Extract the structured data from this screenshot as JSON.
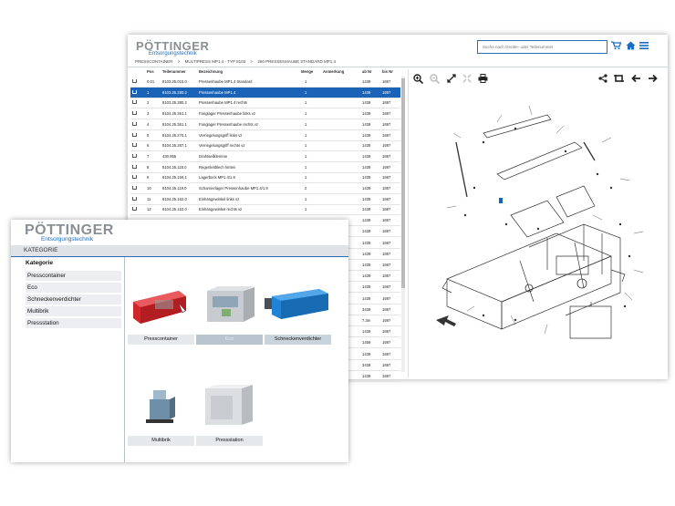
{
  "back": {
    "logo": {
      "name": "PÖTTINGER",
      "sub": "Entsorgungstechnik"
    },
    "search": {
      "placeholder": "Suche nach Geräte- oder Teilenummer"
    },
    "icons": {
      "cart": "cart-icon",
      "home": "home-icon",
      "menu": "menu-icon"
    },
    "breadcrumb": [
      "PRESSCONTAINER",
      ">",
      "MULTIPRESS MP1.4 - TYP 8103",
      ">",
      "260 PRESSENHAUBE STANDARD MP1.4"
    ],
    "table": {
      "headers": [
        "Pos",
        "Teilenummer",
        "Bezeichnung",
        "Menge",
        "Anmerkung",
        "ab Nr",
        "bis Nr"
      ],
      "rows": [
        {
          "pos": "0.01",
          "part": "8103.25.015.0",
          "name": "Pressenhaube MP1.4 Standard",
          "qty": "1",
          "note": "",
          "from": "1439",
          "to": "1697",
          "selected": false
        },
        {
          "pos": "1",
          "part": "8103.25.280.2",
          "name": "Pressenhaube MP1.4",
          "qty": "1",
          "note": "",
          "from": "1439",
          "to": "1697",
          "selected": true
        },
        {
          "pos": "2",
          "part": "8103.25.380.2",
          "name": "Pressenhaube MP1.4 rechts",
          "qty": "1",
          "note": "",
          "from": "1439",
          "to": "1697",
          "selected": false
        },
        {
          "pos": "3",
          "part": "8104.25.351.1",
          "name": "Fanglager Pressenhaube links vz",
          "qty": "1",
          "note": "",
          "from": "1439",
          "to": "1697",
          "selected": false
        },
        {
          "pos": "4",
          "part": "8104.25.361.1",
          "name": "Fanglager Pressenhaube rechts vz",
          "qty": "1",
          "note": "",
          "from": "1439",
          "to": "1697",
          "selected": false
        },
        {
          "pos": "5",
          "part": "8104.25.270.1",
          "name": "Verriegelungsgriff links vz",
          "qty": "1",
          "note": "",
          "from": "1439",
          "to": "1697",
          "selected": false
        },
        {
          "pos": "6",
          "part": "8104.25.267.1",
          "name": "Verriegelungsgriff rechts vz",
          "qty": "1",
          "note": "",
          "from": "1439",
          "to": "1697",
          "selected": false
        },
        {
          "pos": "7",
          "part": "430.955",
          "name": "Drahtseilklemme",
          "qty": "1",
          "note": "",
          "from": "1439",
          "to": "1697",
          "selected": false
        },
        {
          "pos": "8",
          "part": "8104.25.118.0",
          "name": "Regenleitblech hinten",
          "qty": "1",
          "note": "",
          "from": "1439",
          "to": "1697",
          "selected": false
        },
        {
          "pos": "9",
          "part": "8104.25.156.1",
          "name": "Lagerbock MP1.4/1.9",
          "qty": "1",
          "note": "",
          "from": "1439",
          "to": "1697",
          "selected": false
        },
        {
          "pos": "10",
          "part": "8104.25.119.0",
          "name": "Scharnierlager Pressenhaube MP1.4/1.9",
          "qty": "2",
          "note": "",
          "from": "1439",
          "to": "1697",
          "selected": false
        },
        {
          "pos": "11",
          "part": "8104.25.152.0",
          "name": "Einhängewinkel links vz",
          "qty": "1",
          "note": "",
          "from": "1439",
          "to": "1697",
          "selected": false
        },
        {
          "pos": "12",
          "part": "8104.25.153.0",
          "name": "Einhängewinkel rechts vz",
          "qty": "1",
          "note": "",
          "from": "1439",
          "to": "1697",
          "selected": false
        }
      ],
      "hidden_rows": [
        {
          "from": "1439",
          "to": "1697"
        },
        {
          "from": "1439",
          "to": "1697"
        },
        {
          "from": "1439",
          "to": "1697"
        },
        {
          "from": "1439",
          "to": "1697"
        },
        {
          "from": "1439",
          "to": "1697"
        },
        {
          "from": "1439",
          "to": "1697"
        },
        {
          "from": "1439",
          "to": "1697"
        },
        {
          "from": "1439",
          "to": "1697"
        },
        {
          "from": "3439",
          "to": "1697"
        },
        {
          "from": "7.3m",
          "to": "1697"
        },
        {
          "from": "1439",
          "to": "1697"
        },
        {
          "from": "1459",
          "to": "1697"
        },
        {
          "from": "1439",
          "to": "1697"
        },
        {
          "from": "3439",
          "to": "1697"
        },
        {
          "from": "1439",
          "to": "1697"
        }
      ]
    },
    "drawing_icons": [
      "zoom-in-icon",
      "zoom-out-icon",
      "fullscreen-icon",
      "fit-icon",
      "print-icon",
      "share-icon",
      "sync-icon",
      "arrow-left-icon",
      "arrow-right-icon"
    ]
  },
  "front": {
    "logo": {
      "name": "PÖTTINGER",
      "sub": "Entsorgungstechnik"
    },
    "title": "KATEGORIE",
    "sidebar": {
      "heading": "Kategorie",
      "items": [
        "Presscontainer",
        "Eco",
        "Schneckenverdichter",
        "Multibrik",
        "Pressstation"
      ]
    },
    "cards": [
      {
        "label": "Presscontainer",
        "state": "normal"
      },
      {
        "label": "Eco",
        "state": "disabled"
      },
      {
        "label": "Schneckenverdichter",
        "state": "highlight"
      },
      {
        "label": "Multibrik",
        "state": "normal"
      },
      {
        "label": "Pressstation",
        "state": "normal"
      }
    ]
  },
  "colors": {
    "accent": "#1b63b7",
    "logo_gray": "#8a8f96",
    "sidebar_bg": "#eceef1",
    "red_container": "#d0262b",
    "blue_container": "#1f84d6"
  }
}
